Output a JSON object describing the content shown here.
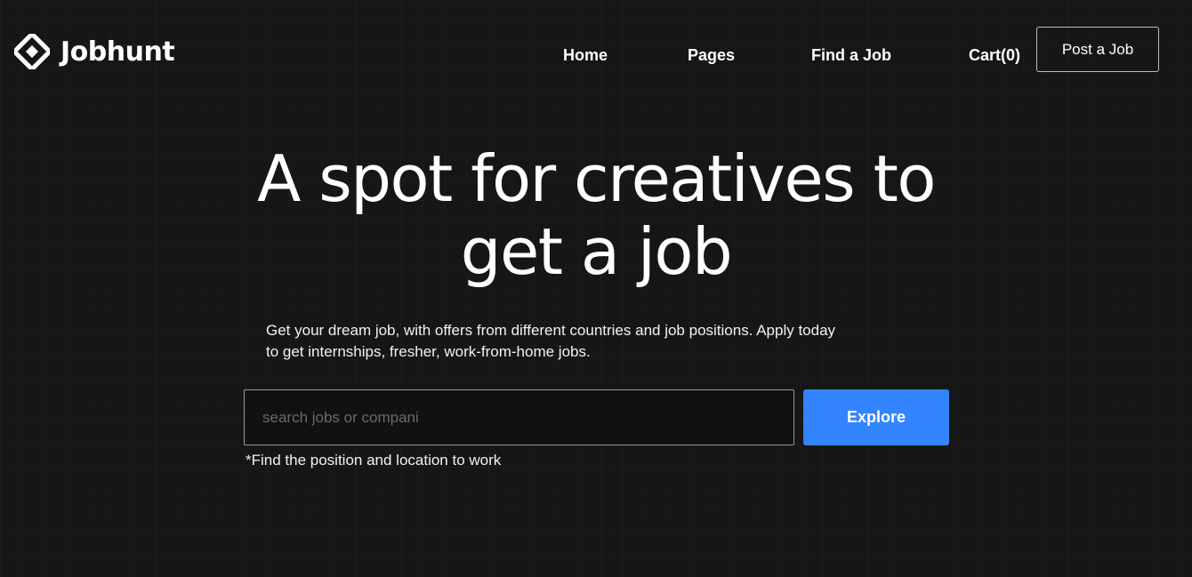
{
  "header": {
    "brand": "Jobhunt",
    "logo_icon": "diamond-grid-icon",
    "nav": [
      {
        "label": "Home"
      },
      {
        "label": "Pages"
      },
      {
        "label": "Find a Job"
      },
      {
        "label": "Cart(0)"
      }
    ],
    "cta_label": "Post a Job"
  },
  "hero": {
    "title_line1": "A spot for creatives to",
    "title_line2": "get a job",
    "subtitle_line1": "Get your dream job, with offers from different countries and job positions. Apply today",
    "subtitle_line2": "to get internships, fresher, work-from-home jobs."
  },
  "search": {
    "placeholder": "search jobs or compani",
    "value": "",
    "button_label": "Explore",
    "hint": "*Find the position and location to work"
  },
  "colors": {
    "background": "#161616",
    "accent": "#3284ff",
    "text": "#ffffff"
  }
}
